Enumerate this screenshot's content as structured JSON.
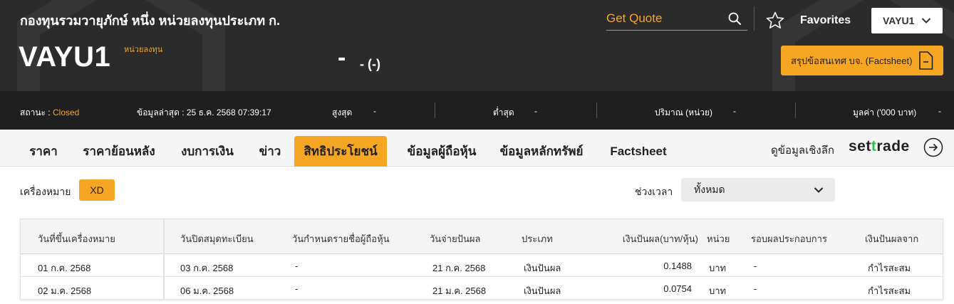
{
  "header": {
    "fund_name": "กองทุนรวมวายุภักษ์ หนึ่ง หน่วยลงทุนประเภท ก.",
    "symbol": "VAYU1",
    "unit_type_tag": "หน่วยลงทุน",
    "price": "-",
    "price_change": "- (-)",
    "search_placeholder": "Get Quote",
    "favorites_label": "Favorites",
    "selected_symbol": "VAYU1",
    "factsheet_button": "สรุปข้อสนเทศ บจ. (Factsheet)"
  },
  "status_bar": {
    "status_label": "สถานะ :",
    "status_value": "Closed",
    "last_update": "ข้อมูลล่าสุด : 25 ธ.ค. 2568 07:39:17",
    "high_label": "สูงสุด",
    "high_value": "-",
    "low_label": "ต่ำสุด",
    "low_value": "-",
    "volume_label": "ปริมาณ (หน่วย)",
    "volume_value": "-",
    "value_label": "มูลค่า ('000 บาท)",
    "value_value": "-"
  },
  "tabs": [
    {
      "label": "ราคา"
    },
    {
      "label": "ราคาย้อนหลัง"
    },
    {
      "label": "งบการเงิน"
    },
    {
      "label": "ข่าว"
    },
    {
      "label": "สิทธิประโยชน์"
    },
    {
      "label": "ข้อมูลผู้ถือหุ้น"
    },
    {
      "label": "ข้อมูลหลักทรัพย์"
    },
    {
      "label": "Factsheet"
    }
  ],
  "active_tab": "สิทธิประโยชน์",
  "deep_link": "ดูข้อมูลเชิงลึก",
  "brand": {
    "pre": "set",
    "mid": "t",
    "post": "rade"
  },
  "filters": {
    "sign_label": "เครื่องหมาย",
    "sign_chip": "XD",
    "period_label": "ช่วงเวลา",
    "period_value": "ทั้งหมด"
  },
  "table": {
    "columns": [
      "วันที่ขึ้นเครื่องหมาย",
      "วันปิดสมุดทะเบียน",
      "วันกำหนดรายชื่อผู้ถือหุ้น",
      "วันจ่ายปันผล",
      "ประเภท",
      "เงินปันผล(บาท/หุ้น)",
      "หน่วย",
      "รอบผลประกอบการ",
      "เงินปันผลจาก"
    ],
    "rows": [
      [
        "01 ก.ค. 2568",
        "03 ก.ค. 2568",
        "-",
        "21 ก.ค. 2568",
        "เงินปันผล",
        "0.1488",
        "บาท",
        "-",
        "กำไรสะสม"
      ],
      [
        "02 ม.ค. 2568",
        "06 ม.ค. 2568",
        "-",
        "21 ม.ค. 2568",
        "เงินปันผล",
        "0.0754",
        "บาท",
        "-",
        "กำไรสะสม"
      ]
    ]
  },
  "colors": {
    "accent": "#f5a623",
    "header_bg": "#2b2b2b",
    "statusbar_bg": "#1f1f1f",
    "brand_green": "#2ec04b"
  },
  "icons": {
    "search": "search-icon",
    "star": "star-icon",
    "chevron": "chevron-down-icon",
    "document": "document-icon",
    "arrow": "arrow-right-circle-icon"
  }
}
